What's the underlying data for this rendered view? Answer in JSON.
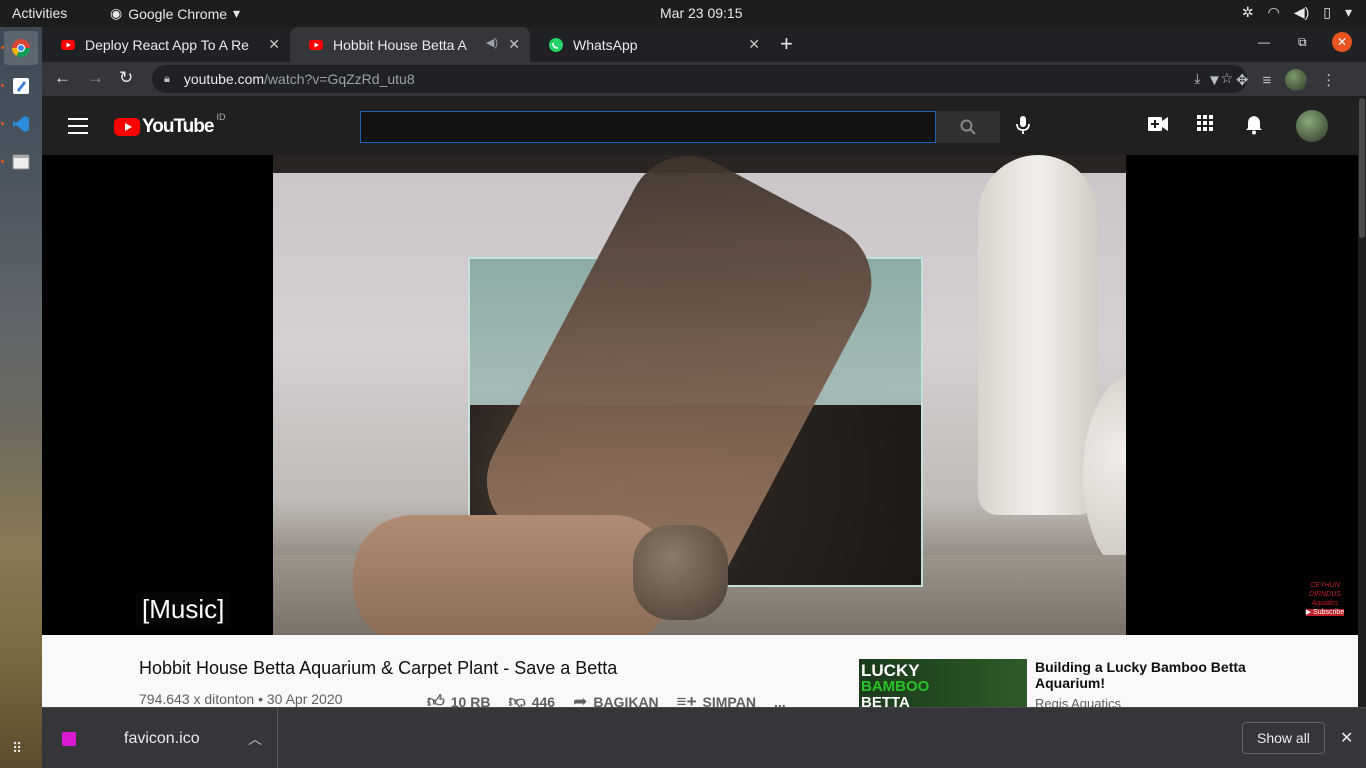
{
  "system": {
    "activities": "Activities",
    "app_menu": "Google Chrome",
    "clock": "Mar 23  09:15"
  },
  "tabs": [
    {
      "title": "Deploy React App To A Re",
      "active": false
    },
    {
      "title": "Hobbit House Betta A",
      "active": true
    },
    {
      "title": "WhatsApp",
      "active": false
    }
  ],
  "toolbar": {
    "url_host": "youtube.com",
    "url_path": "/watch?v=GqZzRd_utu8"
  },
  "youtube": {
    "logo_text": "YouTube",
    "country_code": "ID",
    "search": {
      "value": "",
      "placeholder": ""
    }
  },
  "video": {
    "caption": "[Music]",
    "watermark": "CEYHUN DIRNDUS Aquatics Subscribe",
    "title": "Hobbit House Betta Aquarium & Carpet Plant - Save a Betta",
    "views_date": "794.643 x ditonton • 30 Apr 2020",
    "likes": "10 RB",
    "dislikes": "446",
    "share": "BAGIKAN",
    "save": "SIMPAN",
    "more": "..."
  },
  "recommended": {
    "thumb_line1": "LUCKY",
    "thumb_line2": "BAMBOO",
    "thumb_line3": "BETTA",
    "title": "Building a Lucky Bamboo Betta Aquarium!",
    "channel": "Regis Aquatics"
  },
  "downloads": {
    "file_name": "favicon.ico",
    "show_all": "Show all"
  },
  "colors": {
    "youtube_red": "#ff0000",
    "chrome_dark": "#202124",
    "ubuntu_orange": "#e95420"
  }
}
